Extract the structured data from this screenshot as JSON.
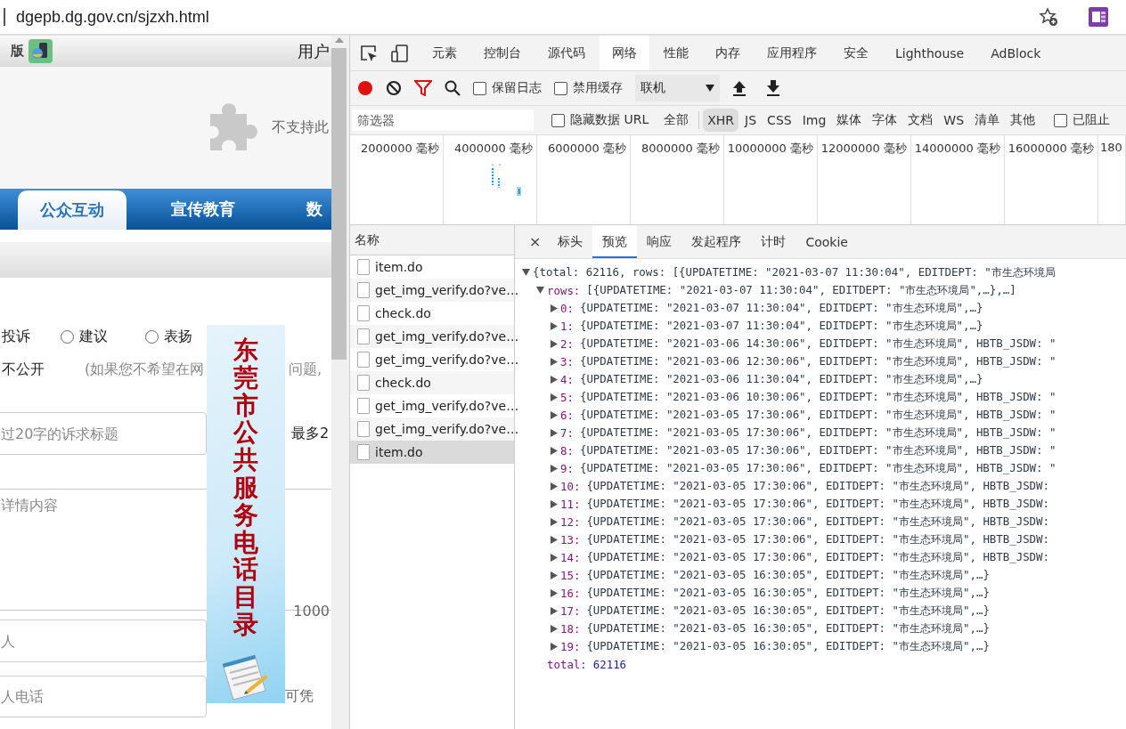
{
  "address_bar": {
    "url": "dgepb.dg.gov.cn/sjzxh.html"
  },
  "page": {
    "header": {
      "mobile_label": "版",
      "user_label": "用户"
    },
    "plugin_notice": "不支持此",
    "nav_tabs": [
      {
        "label": "公众互动",
        "selected": true
      },
      {
        "label": "宣传教育",
        "selected": false
      },
      {
        "label": "数",
        "selected": false
      }
    ],
    "form": {
      "type_label": "投诉",
      "type_options": [
        {
          "label": "建议",
          "selected": false
        },
        {
          "label": "表扬",
          "selected": false
        }
      ],
      "privacy_label": "不公开",
      "privacy_note": "(如果您不希望在网",
      "privacy_note_end": "问题,",
      "title_field": {
        "placeholder": "过20字的诉求标题"
      },
      "title_hint": "最多2",
      "content_field": {
        "placeholder": "详情内容"
      },
      "content_hint": "1000",
      "name_field": {
        "placeholder": "人"
      },
      "phone_field": {
        "placeholder": "人电话"
      },
      "phone_hint": "可凭"
    },
    "banner": {
      "title": "东莞市公共服务电话目录"
    }
  },
  "devtools": {
    "tabs": [
      {
        "label": "元素",
        "selected": false
      },
      {
        "label": "控制台",
        "selected": false
      },
      {
        "label": "源代码",
        "selected": false
      },
      {
        "label": "网络",
        "selected": true
      },
      {
        "label": "性能",
        "selected": false
      },
      {
        "label": "内存",
        "selected": false
      },
      {
        "label": "应用程序",
        "selected": false
      },
      {
        "label": "安全",
        "selected": false
      },
      {
        "label": "Lighthouse",
        "selected": false
      },
      {
        "label": "AdBlock",
        "selected": false
      }
    ],
    "toolbar": {
      "recording": true,
      "filter_active": true,
      "preserve_log": {
        "label": "保留日志",
        "checked": false
      },
      "disable_cache": {
        "label": "禁用缓存",
        "checked": false
      },
      "throttle": "联机"
    },
    "filter_bar": {
      "placeholder": "筛选器",
      "hide_data_urls": {
        "label": "隐藏数据 URL",
        "checked": false
      },
      "types": [
        {
          "label": "全部",
          "selected": false
        },
        {
          "label": "XHR",
          "selected": true
        },
        {
          "label": "JS",
          "selected": false
        },
        {
          "label": "CSS",
          "selected": false
        },
        {
          "label": "Img",
          "selected": false
        },
        {
          "label": "媒体",
          "selected": false
        },
        {
          "label": "字体",
          "selected": false
        },
        {
          "label": "文档",
          "selected": false
        },
        {
          "label": "WS",
          "selected": false
        },
        {
          "label": "清单",
          "selected": false
        },
        {
          "label": "其他",
          "selected": false
        }
      ],
      "blocked": {
        "label": "已阻止",
        "checked": false
      }
    },
    "overview": {
      "ticks": [
        "2000000 毫秒",
        "4000000 毫秒",
        "6000000 毫秒",
        "8000000 毫秒",
        "10000000 毫秒",
        "12000000 毫秒",
        "14000000 毫秒",
        "16000000 毫秒",
        "180"
      ]
    },
    "requests": {
      "header": "名称",
      "items": [
        {
          "name": "item.do",
          "selected": false
        },
        {
          "name": "get_img_verify.do?ve…",
          "selected": false
        },
        {
          "name": "check.do",
          "selected": false
        },
        {
          "name": "get_img_verify.do?ve…",
          "selected": false
        },
        {
          "name": "get_img_verify.do?ve…",
          "selected": false
        },
        {
          "name": "check.do",
          "selected": false
        },
        {
          "name": "get_img_verify.do?ve…",
          "selected": false
        },
        {
          "name": "get_img_verify.do?ve…",
          "selected": false
        },
        {
          "name": "item.do",
          "selected": true
        }
      ]
    },
    "detail": {
      "close": "×",
      "tabs": [
        {
          "label": "标头",
          "selected": false
        },
        {
          "label": "预览",
          "selected": true
        },
        {
          "label": "响应",
          "selected": false
        },
        {
          "label": "发起程序",
          "selected": false
        },
        {
          "label": "计时",
          "selected": false
        },
        {
          "label": "Cookie",
          "selected": false
        }
      ],
      "preview": {
        "root": {
          "summary": "{total: 62116, rows: [{UPDATETIME: \"2021-03-07 11:30:04\", EDITDEPT: \"市生态环境局",
          "expanded": true
        },
        "rows": {
          "key": "rows:",
          "summary": "[{UPDATETIME: \"2021-03-07 11:30:04\", EDITDEPT: \"市生态环境局\",…},…]",
          "expanded": true,
          "items": [
            {
              "index": "0:",
              "summary": "{UPDATETIME: \"2021-03-07 11:30:04\", EDITDEPT: \"市生态环境局\",…}",
              "expanded": false
            },
            {
              "index": "1:",
              "summary": "{UPDATETIME: \"2021-03-07 11:30:04\", EDITDEPT: \"市生态环境局\",…}",
              "expanded": false
            },
            {
              "index": "2:",
              "summary": "{UPDATETIME: \"2021-03-06 14:30:06\", EDITDEPT: \"市生态环境局\", HBTB_JSDW: \"",
              "expanded": false
            },
            {
              "index": "3:",
              "summary": "{UPDATETIME: \"2021-03-06 12:30:06\", EDITDEPT: \"市生态环境局\", HBTB_JSDW: \"",
              "expanded": false
            },
            {
              "index": "4:",
              "summary": "{UPDATETIME: \"2021-03-06 11:30:04\", EDITDEPT: \"市生态环境局\",…}",
              "expanded": false
            },
            {
              "index": "5:",
              "summary": "{UPDATETIME: \"2021-03-06 10:30:06\", EDITDEPT: \"市生态环境局\", HBTB_JSDW: \"",
              "expanded": false
            },
            {
              "index": "6:",
              "summary": "{UPDATETIME: \"2021-03-05 17:30:06\", EDITDEPT: \"市生态环境局\", HBTB_JSDW: \"",
              "expanded": false
            },
            {
              "index": "7:",
              "summary": "{UPDATETIME: \"2021-03-05 17:30:06\", EDITDEPT: \"市生态环境局\", HBTB_JSDW: \"",
              "expanded": false
            },
            {
              "index": "8:",
              "summary": "{UPDATETIME: \"2021-03-05 17:30:06\", EDITDEPT: \"市生态环境局\", HBTB_JSDW: \"",
              "expanded": false
            },
            {
              "index": "9:",
              "summary": "{UPDATETIME: \"2021-03-05 17:30:06\", EDITDEPT: \"市生态环境局\", HBTB_JSDW: \"",
              "expanded": false
            },
            {
              "index": "10:",
              "summary": "{UPDATETIME: \"2021-03-05 17:30:06\", EDITDEPT: \"市生态环境局\", HBTB_JSDW:",
              "expanded": false
            },
            {
              "index": "11:",
              "summary": "{UPDATETIME: \"2021-03-05 17:30:06\", EDITDEPT: \"市生态环境局\", HBTB_JSDW:",
              "expanded": false
            },
            {
              "index": "12:",
              "summary": "{UPDATETIME: \"2021-03-05 17:30:06\", EDITDEPT: \"市生态环境局\", HBTB_JSDW:",
              "expanded": false
            },
            {
              "index": "13:",
              "summary": "{UPDATETIME: \"2021-03-05 17:30:06\", EDITDEPT: \"市生态环境局\", HBTB_JSDW:",
              "expanded": false
            },
            {
              "index": "14:",
              "summary": "{UPDATETIME: \"2021-03-05 17:30:06\", EDITDEPT: \"市生态环境局\", HBTB_JSDW:",
              "expanded": false
            },
            {
              "index": "15:",
              "summary": "{UPDATETIME: \"2021-03-05 16:30:05\", EDITDEPT: \"市生态环境局\",…}",
              "expanded": false
            },
            {
              "index": "16:",
              "summary": "{UPDATETIME: \"2021-03-05 16:30:05\", EDITDEPT: \"市生态环境局\",…}",
              "expanded": false
            },
            {
              "index": "17:",
              "summary": "{UPDATETIME: \"2021-03-05 16:30:05\", EDITDEPT: \"市生态环境局\",…}",
              "expanded": false
            },
            {
              "index": "18:",
              "summary": "{UPDATETIME: \"2021-03-05 16:30:05\", EDITDEPT: \"市生态环境局\",…}",
              "expanded": false
            },
            {
              "index": "19:",
              "summary": "{UPDATETIME: \"2021-03-05 16:30:05\", EDITDEPT: \"市生态环境局\",…}",
              "expanded": false
            }
          ]
        },
        "total": {
          "key": "total:",
          "value": "62116"
        }
      }
    }
  }
}
